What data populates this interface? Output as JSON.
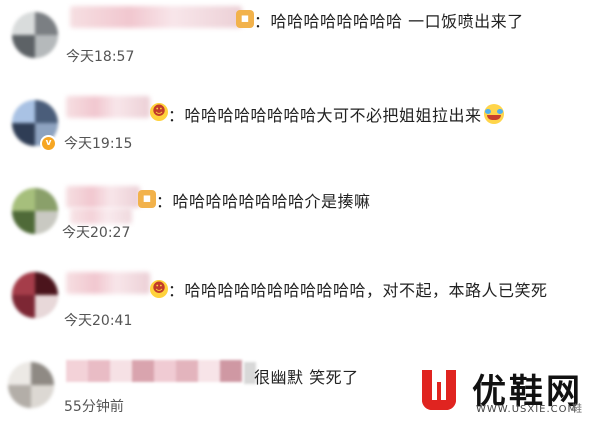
{
  "comments": [
    {
      "text": "：哈哈哈哈哈哈哈哈 一口饭喷出来了",
      "time": "今天18:57",
      "badge": "gold"
    },
    {
      "text": "：哈哈哈哈哈哈哈哈大可不必把姐姐拉出来",
      "time": "今天19:15",
      "badge": "face"
    },
    {
      "text": "：哈哈哈哈哈哈哈哈介是揍嘛",
      "time": "今天20:27",
      "badge": "gold"
    },
    {
      "text": "：哈哈哈哈哈哈哈哈哈哈哈，对不起，本路人已笑死",
      "time": "今天20:41",
      "badge": "face"
    },
    {
      "text": "很幽默 笑死了",
      "time": "55分钟前",
      "badge": "none"
    }
  ],
  "watermark": {
    "brand": "优鞋网",
    "url": "WWW.USXIE.COM",
    "corner": "鞋"
  },
  "colors": {
    "brand_red": "#e02420",
    "name_blur_pink": "#f1c7cf",
    "time_gray": "#555555"
  }
}
